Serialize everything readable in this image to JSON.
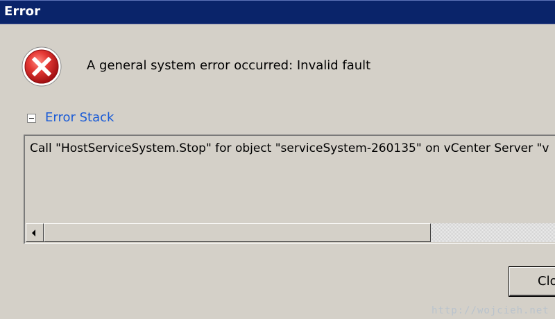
{
  "window": {
    "title": "Error"
  },
  "dialog": {
    "message": "A general system error occurred: Invalid fault",
    "error_stack_label": "Error Stack",
    "error_stack_text": "Call \"HostServiceSystem.Stop\" for object \"serviceSystem-260135\" on vCenter Server \"v",
    "close_label": "Clo"
  },
  "watermark": {
    "text": "http://wojcieh.net"
  },
  "colors": {
    "titlebar": "#0a246a",
    "link": "#1a5bd6",
    "dialog_background": "#d4d0c8",
    "error_red": "#d6262c"
  },
  "icons": {
    "error": "error-icon",
    "collapse": "collapse-minus-icon",
    "scroll_left": "scroll-left-arrow-icon"
  }
}
